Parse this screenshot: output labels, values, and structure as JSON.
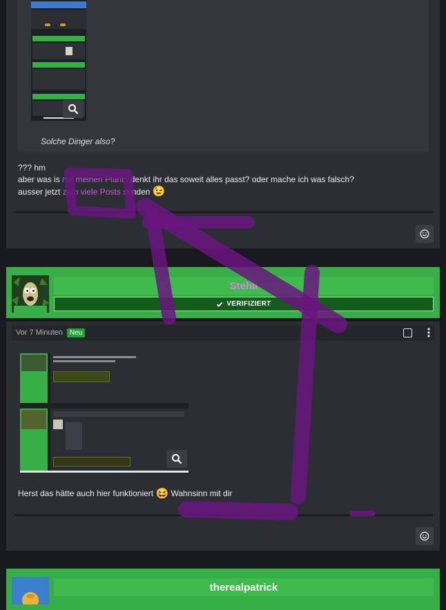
{
  "posts": [
    {
      "quote": {
        "caption": "Solche Dinger also?",
        "image_action_icon": "search-icon"
      },
      "body": {
        "line1": "??? hm",
        "line2_pre": "aber was is ",
        "line2_link": "mit meinen Plants",
        "line2_post": " denkt ihr das soweit alles passt? oder mache ich was falsch?",
        "line3_pre": "ausser jetzt ",
        "line3_link": "zum viele Posts se",
        "line3_post": "nden",
        "emoji": "😉"
      },
      "reaction_icon": "smiley-icon"
    },
    {
      "user": {
        "name": "Stehli",
        "badge": "VERIFIZIERT"
      },
      "meta": {
        "time": "Vor 7 Minuten",
        "new_label": "Neu"
      },
      "body": {
        "text_pre": "Herst das hätte auch hier funktioniert ",
        "emoji": "😆",
        "text_post": " Wahnsinn mit dir"
      },
      "image_action_icon": "search-icon",
      "reaction_icon": "smiley-icon"
    },
    {
      "user": {
        "name": "therealpatrick"
      }
    }
  ],
  "colors": {
    "accent_green": "#36b046",
    "name_highlight": "#e07fe6",
    "link_purple": "#c45ad6",
    "annotation_purple": "#6a1580"
  }
}
